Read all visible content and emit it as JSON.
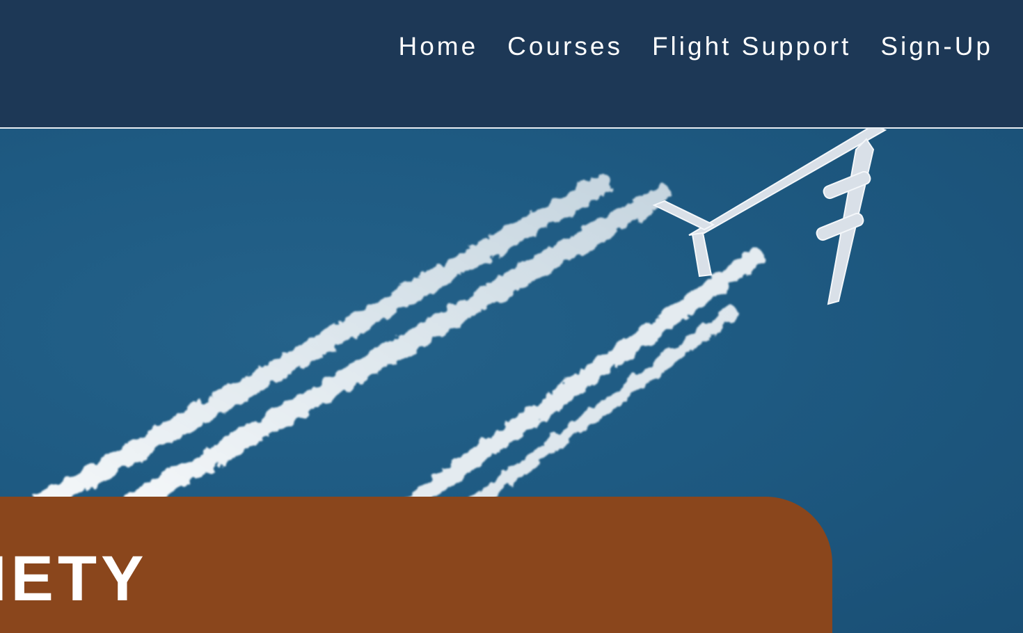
{
  "nav": {
    "items": [
      {
        "label": "Home"
      },
      {
        "label": "Courses"
      },
      {
        "label": "Flight Support"
      },
      {
        "label": "Sign-Up"
      }
    ]
  },
  "banner": {
    "title": "IETY"
  },
  "colors": {
    "header_bg": "#1d3856",
    "sky": "#1f5a80",
    "banner_bg": "#8a461c",
    "text": "#ffffff"
  }
}
